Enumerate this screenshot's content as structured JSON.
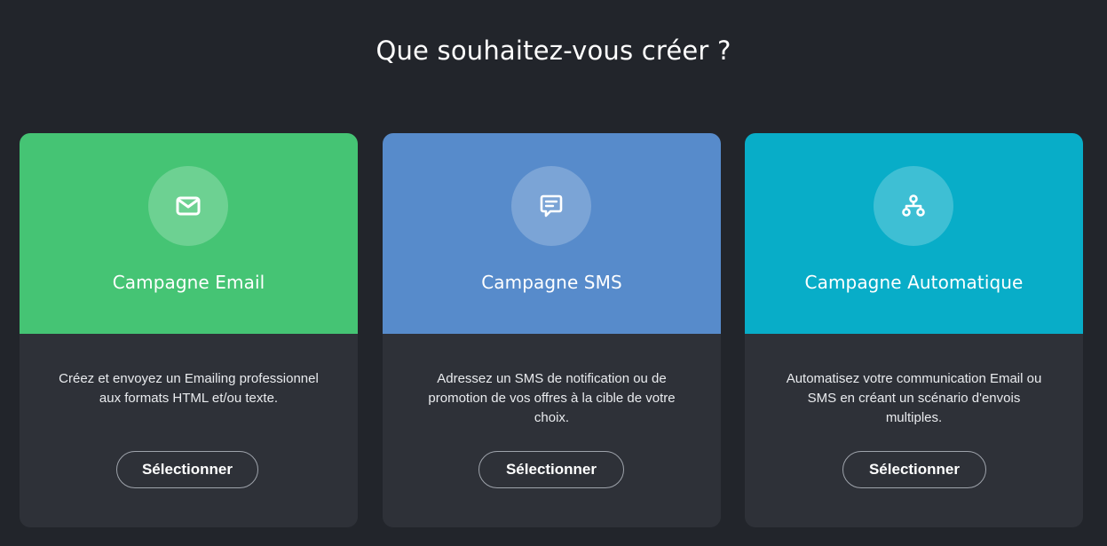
{
  "header": {
    "title": "Que souhaitez-vous créer ?"
  },
  "cards": [
    {
      "title": "Campagne Email",
      "description": "Créez et envoyez un Emailing professionnel aux formats HTML et/ou texte.",
      "button_label": "Sélectionner",
      "icon": "envelope-icon",
      "color": "#45c474"
    },
    {
      "title": "Campagne SMS",
      "description": "Adressez un SMS de notification ou de promotion de vos offres à la cible de votre choix.",
      "button_label": "Sélectionner",
      "icon": "message-icon",
      "color": "#578bcb"
    },
    {
      "title": "Campagne Automatique",
      "description": "Automatisez votre communication Email ou SMS en créant un scénario d'envois multiples.",
      "button_label": "Sélectionner",
      "icon": "workflow-icon",
      "color": "#08adc8"
    }
  ],
  "colors": {
    "background": "#22252b",
    "card_body": "#2e3138"
  }
}
